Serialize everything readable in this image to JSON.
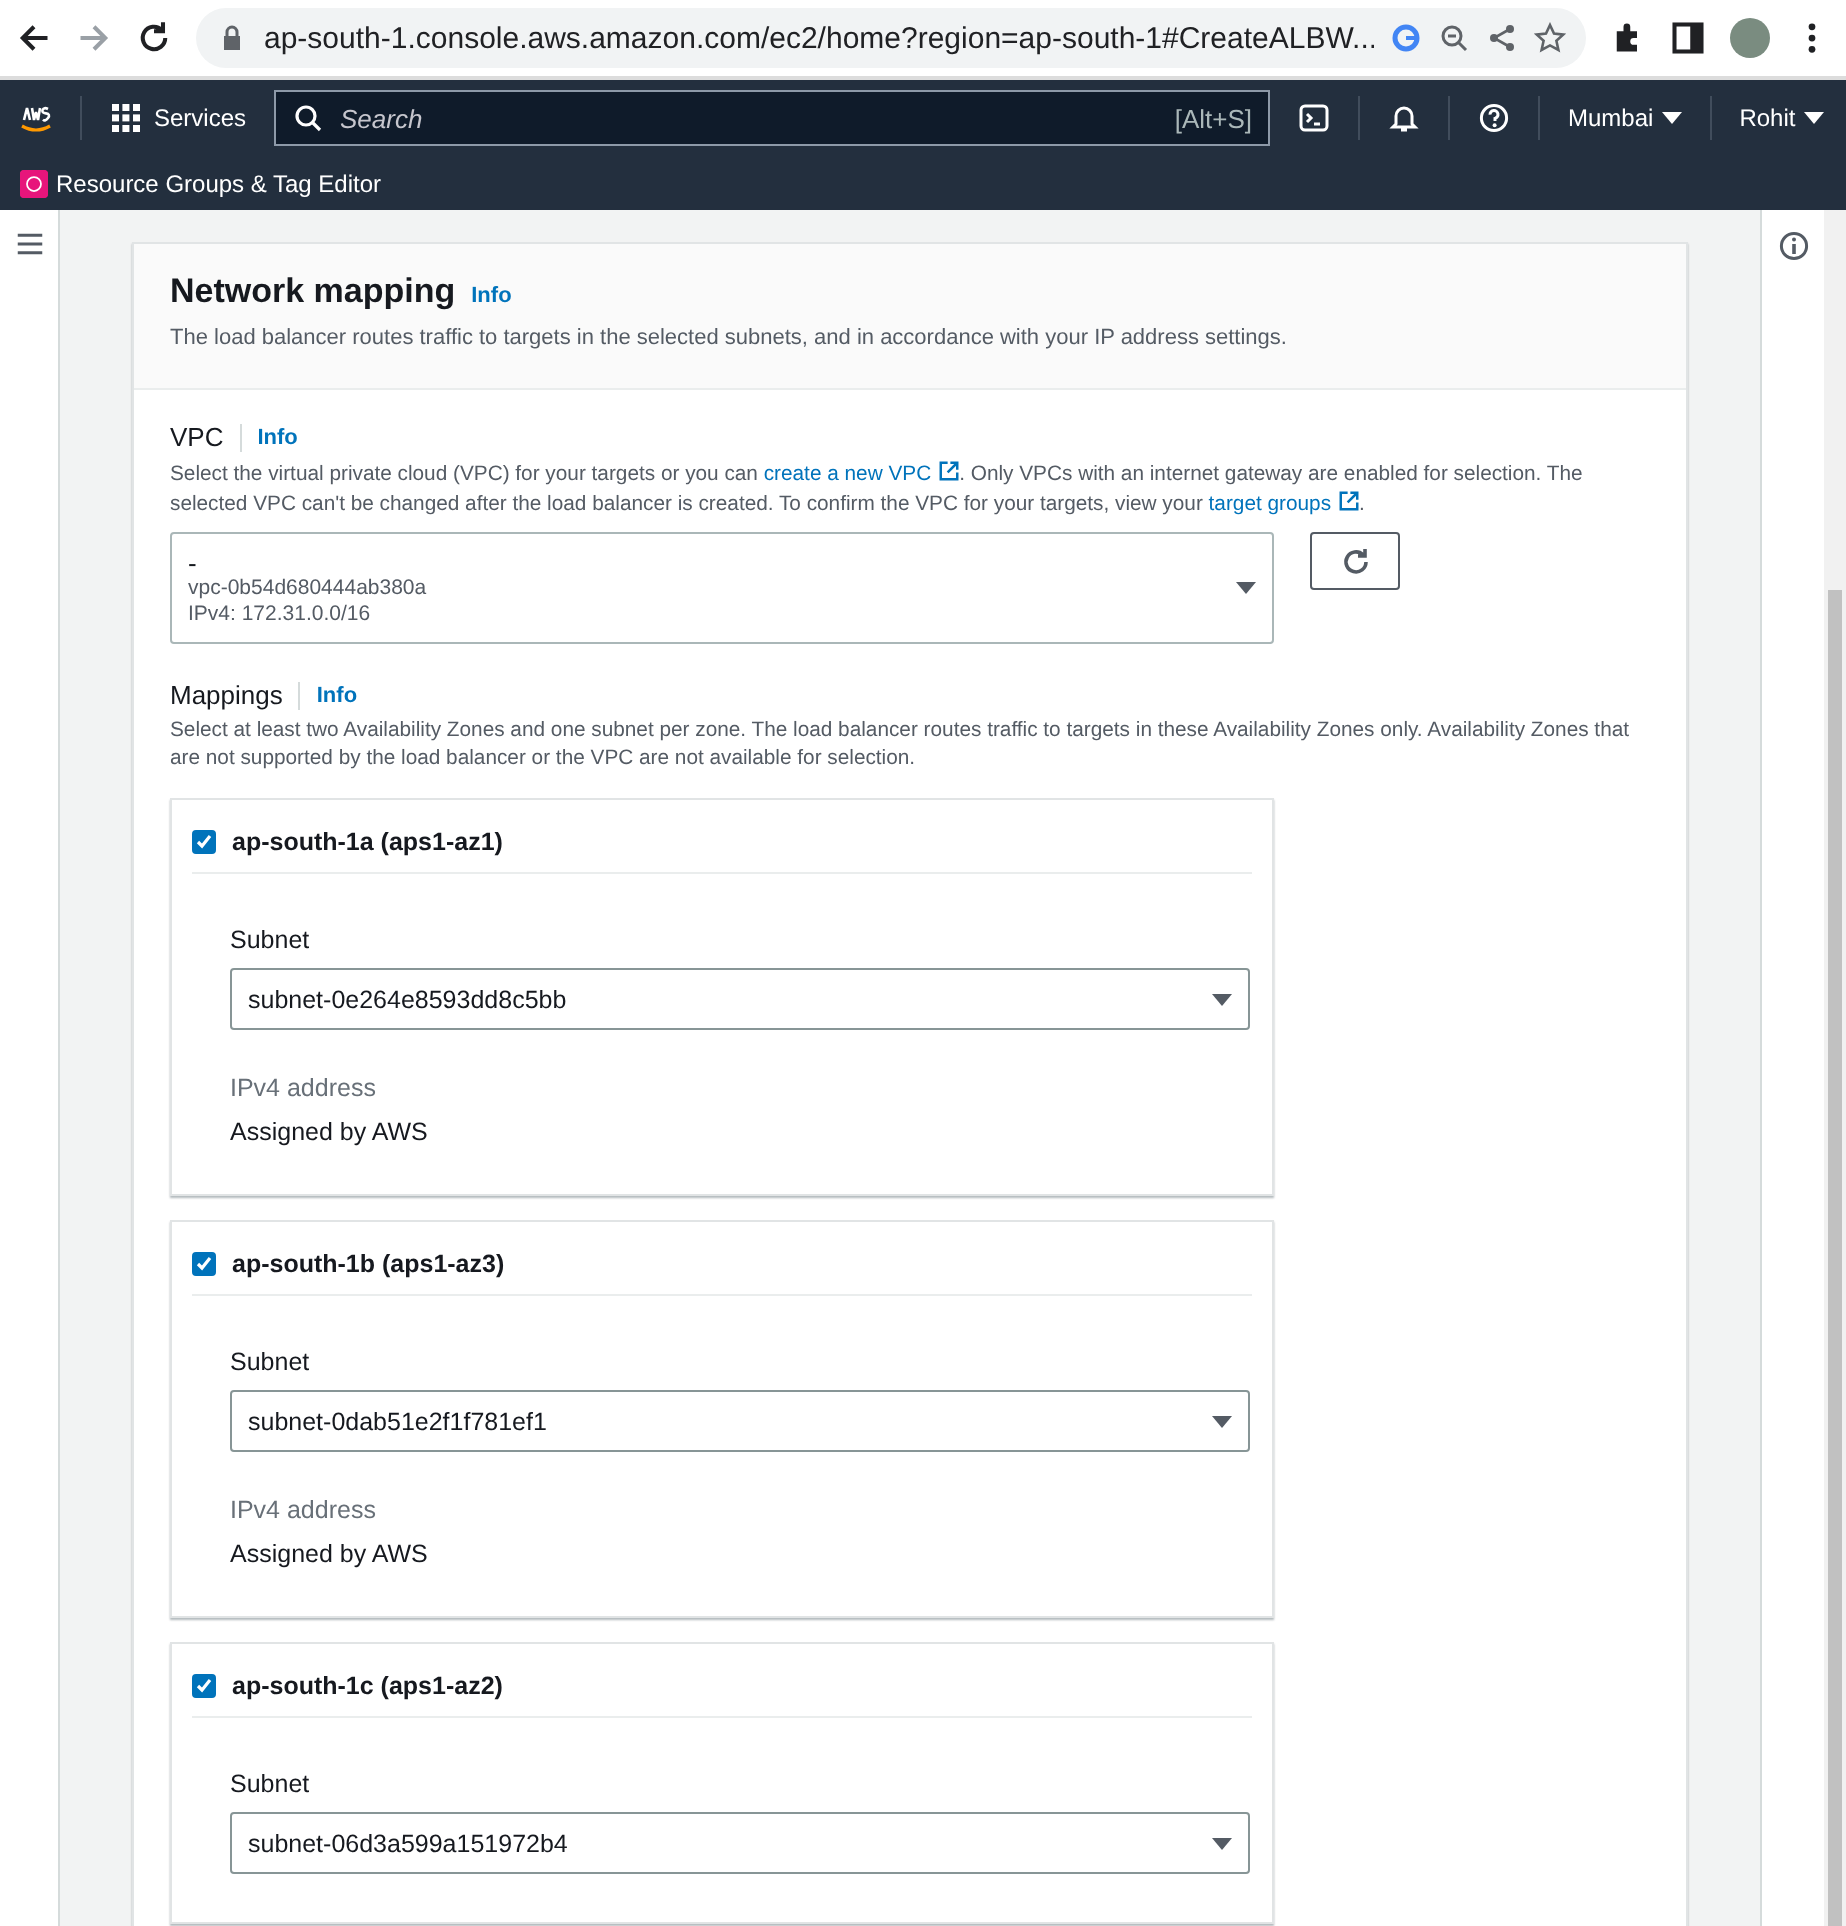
{
  "browser": {
    "url": "ap-south-1.console.aws.amazon.com/ec2/home?region=ap-south-1#CreateALBW..."
  },
  "nav": {
    "services": "Services",
    "search_placeholder": "Search",
    "shortcut": "[Alt+S]",
    "region": "Mumbai",
    "user": "Rohit"
  },
  "favorites": [
    "Resource Groups & Tag Editor"
  ],
  "section": {
    "title": "Network mapping",
    "info": "Info",
    "description": "The load balancer routes traffic to targets in the selected subnets, and in accordance with your IP address settings."
  },
  "vpc": {
    "label": "VPC",
    "info": "Info",
    "help": [
      {
        "kind": "text",
        "text": "Select the virtual private cloud (VPC) for your targets or you can "
      },
      {
        "kind": "link",
        "text": "create a new VPC"
      },
      {
        "kind": "text",
        "text": ". Only VPCs with an internet gateway are enabled for selection. The selected VPC can't be changed after the load balancer is created. To confirm the VPC for your targets, view your "
      },
      {
        "kind": "link",
        "text": "target groups"
      },
      {
        "kind": "text",
        "text": "."
      }
    ],
    "value": "-",
    "id": "vpc-0b54d680444ab380a",
    "cidr": "IPv4: 172.31.0.0/16"
  },
  "mappings": {
    "label": "Mappings",
    "info": "Info",
    "description": "Select at least two Availability Zones and one subnet per zone. The load balancer routes traffic to targets in these Availability Zones only. Availability Zones that are not supported by the load balancer or the VPC are not available for selection.",
    "zones": [
      {
        "name": "ap-south-1a (aps1-az1)",
        "checked": true,
        "subnet_label": "Subnet",
        "subnet": "subnet-0e264e8593dd8c5bb",
        "ipv4_label": "IPv4 address",
        "ipv4": "Assigned by AWS"
      },
      {
        "name": "ap-south-1b (aps1-az3)",
        "checked": true,
        "subnet_label": "Subnet",
        "subnet": "subnet-0dab51e2f1f781ef1",
        "ipv4_label": "IPv4 address",
        "ipv4": "Assigned by AWS"
      },
      {
        "name": "ap-south-1c (aps1-az2)",
        "checked": true,
        "subnet_label": "Subnet",
        "subnet": "subnet-06d3a599a151972b4"
      }
    ]
  }
}
